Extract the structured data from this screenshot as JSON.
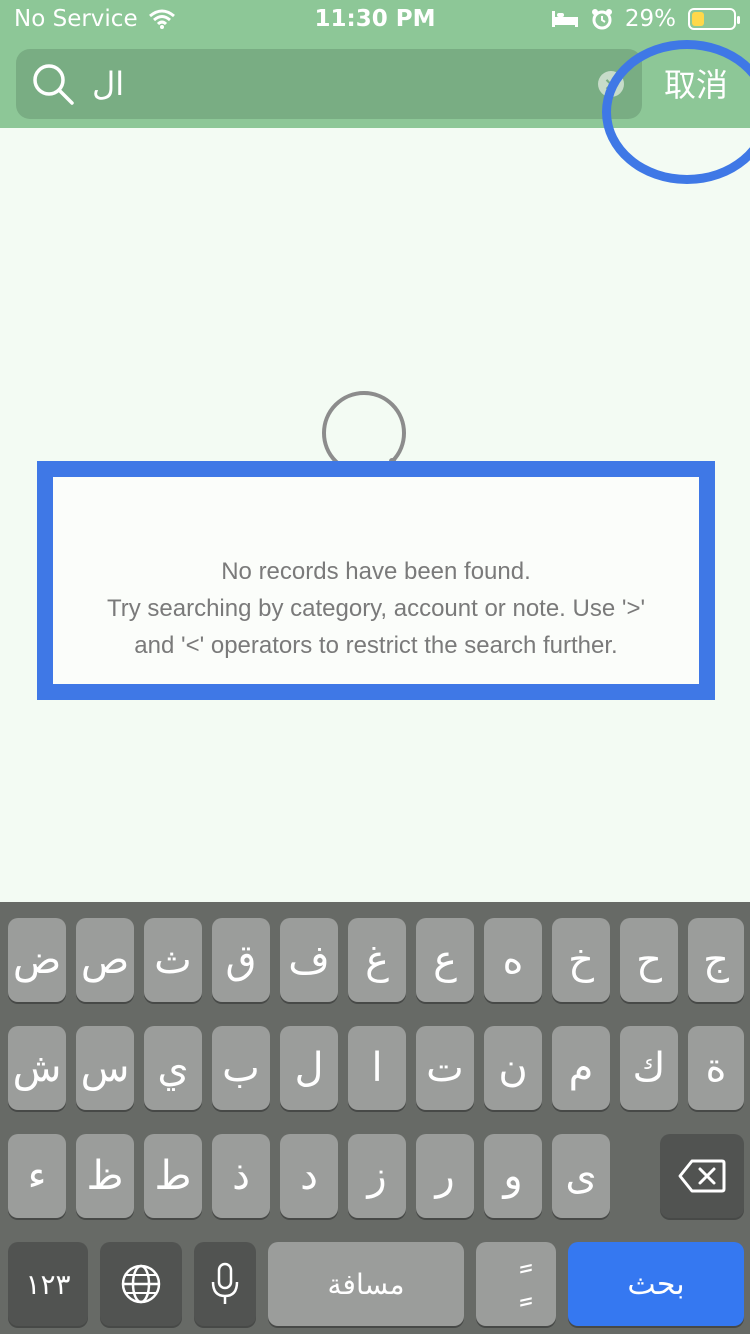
{
  "status_bar": {
    "carrier": "No Service",
    "time": "11:30 PM",
    "battery": "29%",
    "battery_fraction": 0.29
  },
  "search": {
    "query": "ال",
    "cancel_label": "取消",
    "icon": "search-icon",
    "clear_icon": "×"
  },
  "empty_state": {
    "icon": "magnifier-icon",
    "lines": [
      "No records have been found.",
      "Try searching by category, account or note. Use '>'",
      "and '<' operators to restrict the search further."
    ]
  },
  "keyboard": {
    "row1": [
      "ض",
      "ص",
      "ث",
      "ق",
      "ف",
      "غ",
      "ع",
      "ه",
      "خ",
      "ح",
      "ج"
    ],
    "row2": [
      "ش",
      "س",
      "ي",
      "ب",
      "ل",
      "ا",
      "ت",
      "ن",
      "م",
      "ك",
      "ة"
    ],
    "row3": [
      "ء",
      "ظ",
      "ط",
      "ذ",
      "د",
      "ز",
      "ر",
      "و",
      "ى"
    ],
    "numbers_label": "١٢٣",
    "space_label": "مسافة",
    "diacritic_label": "ًٍ",
    "search_label": "بحث"
  },
  "colors": {
    "header": "#8dc797",
    "highlight": "#3f78e6",
    "keyboard": "#676a66"
  }
}
